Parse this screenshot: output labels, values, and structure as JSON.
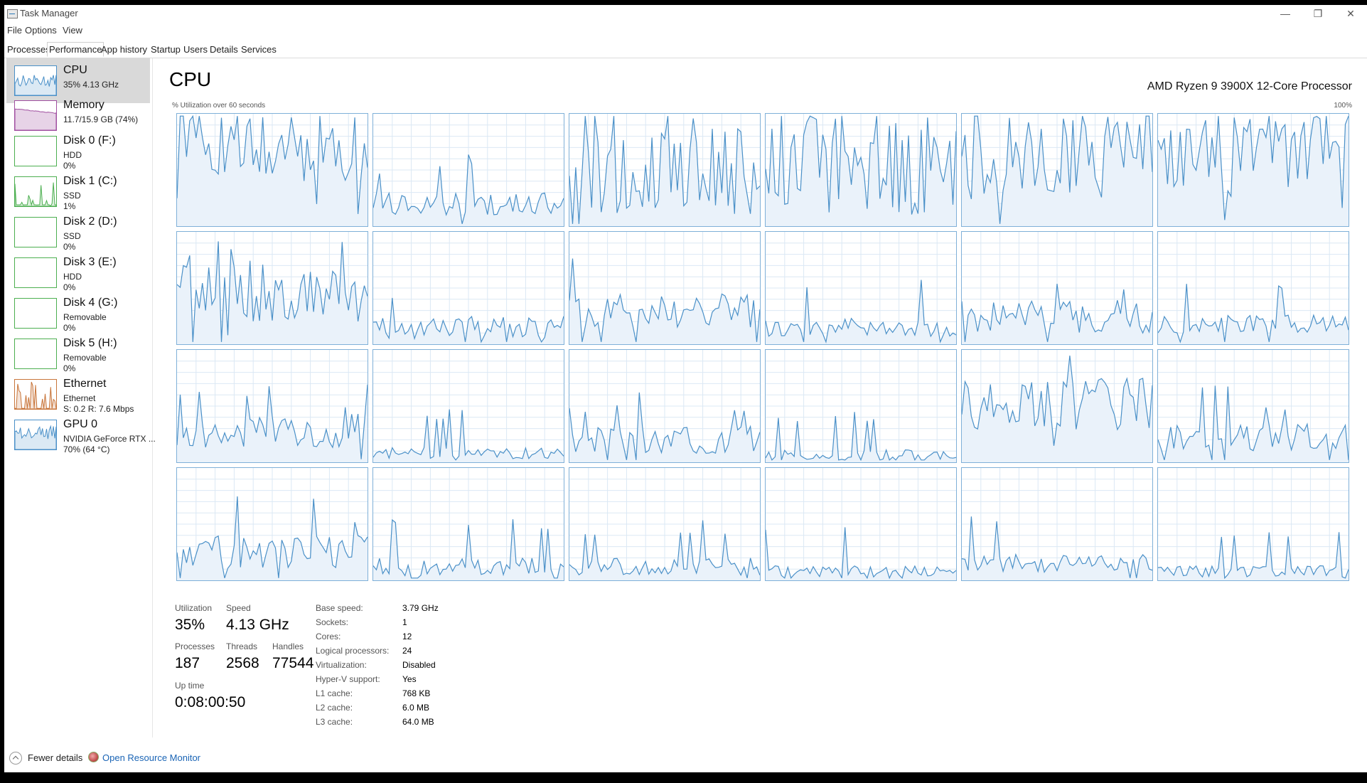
{
  "window": {
    "title": "Task Manager",
    "minimize_glyph": "—",
    "restore_glyph": "❐",
    "close_glyph": "✕"
  },
  "menus": [
    "File",
    "Options",
    "View"
  ],
  "tabs": [
    "Processes",
    "Performance",
    "App history",
    "Startup",
    "Users",
    "Details",
    "Services"
  ],
  "active_tab": "Performance",
  "sidebar": {
    "items": [
      {
        "title": "CPU",
        "subs": [
          "35%  4.13 GHz"
        ],
        "thumb": "cpu",
        "color": "#4a90c8"
      },
      {
        "title": "Memory",
        "subs": [
          "11.7/15.9 GB (74%)"
        ],
        "thumb": "memory",
        "color": "#a04fa0"
      },
      {
        "title": "Disk 0 (F:)",
        "subs": [
          "HDD",
          "0%"
        ],
        "thumb": "disk",
        "color": "#4caf50"
      },
      {
        "title": "Disk 1 (C:)",
        "subs": [
          "SSD",
          "1%"
        ],
        "thumb": "disk-active",
        "color": "#4caf50"
      },
      {
        "title": "Disk 2 (D:)",
        "subs": [
          "SSD",
          "0%"
        ],
        "thumb": "disk",
        "color": "#4caf50"
      },
      {
        "title": "Disk 3 (E:)",
        "subs": [
          "HDD",
          "0%"
        ],
        "thumb": "disk",
        "color": "#4caf50"
      },
      {
        "title": "Disk 4 (G:)",
        "subs": [
          "Removable",
          "0%"
        ],
        "thumb": "disk",
        "color": "#4caf50"
      },
      {
        "title": "Disk 5 (H:)",
        "subs": [
          "Removable",
          "0%"
        ],
        "thumb": "disk",
        "color": "#4caf50"
      },
      {
        "title": "Ethernet",
        "subs": [
          "Ethernet",
          "S: 0.2  R: 7.6 Mbps"
        ],
        "thumb": "ethernet",
        "color": "#c8753a"
      },
      {
        "title": "GPU 0",
        "subs": [
          "NVIDIA GeForce RTX ...",
          "70%  (64 °C)"
        ],
        "thumb": "gpu",
        "color": "#4a90c8"
      }
    ]
  },
  "main": {
    "heading": "CPU",
    "processor": "AMD Ryzen 9 3900X 12-Core Processor",
    "util_label": "% Utilization over 60 seconds",
    "util_max": "100%",
    "graph_color": "#4a90c8",
    "graph_fill": "#eaf2fa",
    "grid_line_color": "#dbe8f4",
    "cores": [
      {
        "level": 0.7,
        "volatility": 0.3
      },
      {
        "level": 0.2,
        "volatility": 0.1
      },
      {
        "level": 0.55,
        "volatility": 0.45
      },
      {
        "level": 0.55,
        "volatility": 0.45
      },
      {
        "level": 0.6,
        "volatility": 0.45
      },
      {
        "level": 0.7,
        "volatility": 0.35
      },
      {
        "level": 0.45,
        "volatility": 0.25
      },
      {
        "level": 0.15,
        "volatility": 0.1
      },
      {
        "level": 0.3,
        "volatility": 0.15
      },
      {
        "level": 0.15,
        "volatility": 0.08
      },
      {
        "level": 0.25,
        "volatility": 0.15
      },
      {
        "level": 0.18,
        "volatility": 0.08
      },
      {
        "level": 0.28,
        "volatility": 0.15
      },
      {
        "level": 0.08,
        "volatility": 0.05
      },
      {
        "level": 0.2,
        "volatility": 0.12
      },
      {
        "level": 0.06,
        "volatility": 0.05
      },
      {
        "level": 0.5,
        "volatility": 0.25
      },
      {
        "level": 0.22,
        "volatility": 0.12
      },
      {
        "level": 0.25,
        "volatility": 0.15
      },
      {
        "level": 0.12,
        "volatility": 0.08
      },
      {
        "level": 0.12,
        "volatility": 0.08
      },
      {
        "level": 0.08,
        "volatility": 0.05
      },
      {
        "level": 0.15,
        "volatility": 0.08
      },
      {
        "level": 0.08,
        "volatility": 0.05
      }
    ]
  },
  "stats": {
    "utilization_label": "Utilization",
    "utilization": "35%",
    "speed_label": "Speed",
    "speed": "4.13 GHz",
    "processes_label": "Processes",
    "processes": "187",
    "threads_label": "Threads",
    "threads": "2568",
    "handles_label": "Handles",
    "handles": "77544",
    "uptime_label": "Up time",
    "uptime": "0:08:00:50"
  },
  "specs": [
    {
      "label": "Base speed:",
      "value": "3.79 GHz"
    },
    {
      "label": "Sockets:",
      "value": "1"
    },
    {
      "label": "Cores:",
      "value": "12"
    },
    {
      "label": "Logical processors:",
      "value": "24"
    },
    {
      "label": "Virtualization:",
      "value": "Disabled"
    },
    {
      "label": "Hyper-V support:",
      "value": "Yes"
    },
    {
      "label": "L1 cache:",
      "value": "768 KB"
    },
    {
      "label": "L2 cache:",
      "value": "6.0 MB"
    },
    {
      "label": "L3 cache:",
      "value": "64.0 MB"
    }
  ],
  "footer": {
    "fewer_details": "Fewer details",
    "resource_monitor": "Open Resource Monitor"
  }
}
